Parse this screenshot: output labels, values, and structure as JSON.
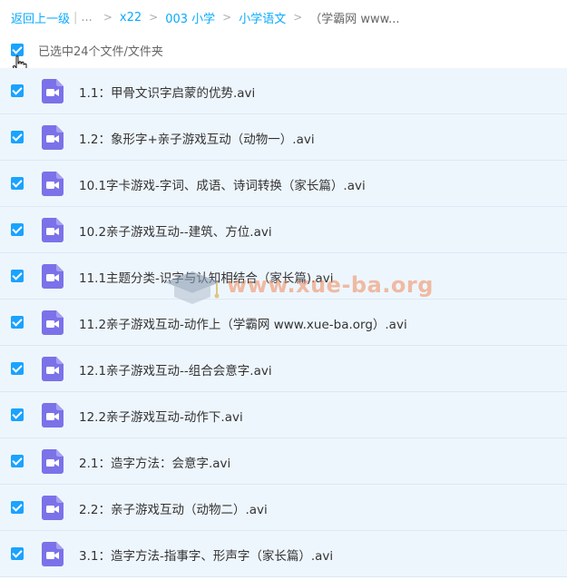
{
  "breadcrumb": {
    "back": "返回上一级",
    "separator": "|",
    "ellipsis": "...",
    "items": [
      "x22",
      "003 小学",
      "小学语文"
    ],
    "current": "（学霸网 www...",
    "sep_glyph": ">"
  },
  "selection": {
    "label": "已选中24个文件/文件夹",
    "checked": true
  },
  "files": [
    {
      "name": "1.1：甲骨文识字启蒙的优势.avi",
      "icon": "video-file-icon",
      "checked": true
    },
    {
      "name": "1.2：象形字+亲子游戏互动（动物一）.avi",
      "icon": "video-file-icon",
      "checked": true
    },
    {
      "name": "10.1字卡游戏-字词、成语、诗词转换（家长篇）.avi",
      "icon": "video-file-icon",
      "checked": true
    },
    {
      "name": "10.2亲子游戏互动--建筑、方位.avi",
      "icon": "video-file-icon",
      "checked": true
    },
    {
      "name": "11.1主题分类-识字与认知相结合（家长篇).avi",
      "icon": "video-file-icon",
      "checked": true
    },
    {
      "name": "11.2亲子游戏互动-动作上（学霸网 www.xue-ba.org）.avi",
      "icon": "video-file-icon",
      "checked": true
    },
    {
      "name": "12.1亲子游戏互动--组合会意字.avi",
      "icon": "video-file-icon",
      "checked": true
    },
    {
      "name": "12.2亲子游戏互动-动作下.avi",
      "icon": "video-file-icon",
      "checked": true
    },
    {
      "name": "2.1：造字方法：会意字.avi",
      "icon": "video-file-icon",
      "checked": true
    },
    {
      "name": "2.2：亲子游戏互动（动物二）.avi",
      "icon": "video-file-icon",
      "checked": true
    },
    {
      "name": "3.1：造字方法-指事字、形声字（家长篇）.avi",
      "icon": "video-file-icon",
      "checked": true
    }
  ],
  "watermark": {
    "text": "www.xue-ba.org"
  },
  "colors": {
    "accent": "#09aaff",
    "checkbox": "#1aa3ff",
    "row_bg": "#eef6fd",
    "video_icon": "#7b72e9"
  }
}
